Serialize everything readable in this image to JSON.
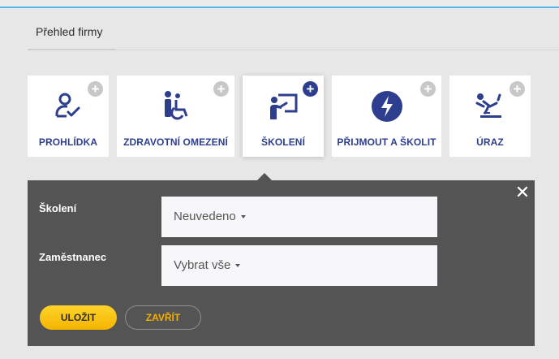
{
  "header": {
    "tab_label": "Přehled firmy"
  },
  "tiles": [
    {
      "label": "PROHLÍDKA",
      "icon": "person-check-icon",
      "plus": "+"
    },
    {
      "label": "ZDRAVOTNÍ OMEZENÍ",
      "icon": "wheelchair-icon",
      "plus": "+"
    },
    {
      "label": "ŠKOLENÍ",
      "icon": "teacher-board-icon",
      "plus": "+"
    },
    {
      "label": "PŘIJMOUT A ŠKOLIT",
      "icon": "lightning-icon",
      "plus": "+"
    },
    {
      "label": "ÚRAZ",
      "icon": "slip-fall-icon",
      "plus": "+"
    }
  ],
  "form": {
    "close_glyph": "✕",
    "training_label": "Školení",
    "training_value": "Neuvedeno",
    "employee_label": "Zaměstnanec",
    "employee_value": "Vybrat vše",
    "save_label": "ULOŽIT",
    "close_label": "ZAVŘÍT"
  },
  "colors": {
    "accent": "#2d3e8f",
    "save": "#f7c10a",
    "panel": "#545454",
    "top_border": "#58b7e6"
  }
}
